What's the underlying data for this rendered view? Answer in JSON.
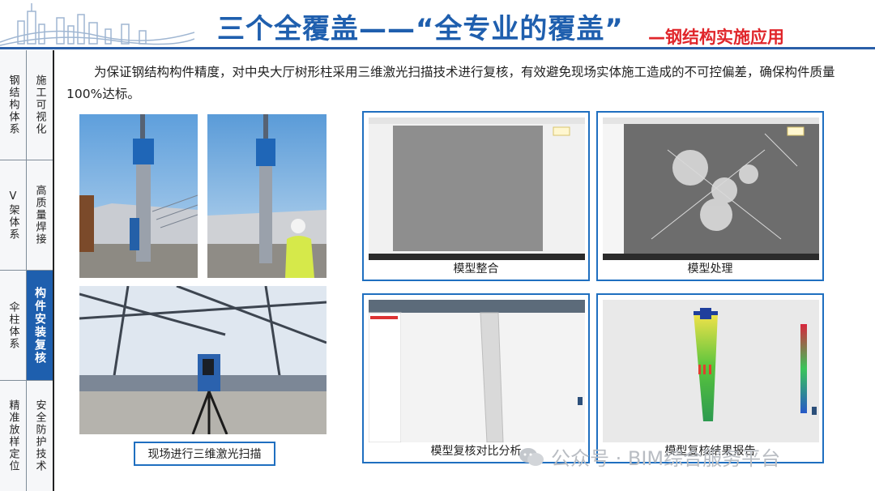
{
  "header": {
    "title": "三个全覆盖——“全专业的覆盖”",
    "subtitle": "—钢结构实施应用",
    "colors": {
      "title": "#1f5fae",
      "subtitle": "#e0262b",
      "accent": "#1e5fae"
    }
  },
  "sidebar": {
    "left": [
      "钢结构体系",
      "V架体系",
      "伞柱体系",
      "精准放样定位"
    ],
    "right": [
      "施工可视化",
      "高质量焊接",
      "构件安装复核",
      "安全防护技术"
    ],
    "active_index": 2
  },
  "intro": "为保证钢结构构件精度，对中央大厅树形柱采用三维激光扫描技术进行复核，有效避免现场实体施工造成的不可控偏差，确保构件质量100%达标。",
  "photos": {
    "caption": "现场进行三维激光扫描"
  },
  "panels": [
    {
      "caption": "模型整合"
    },
    {
      "caption": "模型处理"
    },
    {
      "caption": "模型复核对比分析"
    },
    {
      "caption": "模型复核结果报告"
    }
  ],
  "watermark": "公众号 · BIM综合服务平台"
}
